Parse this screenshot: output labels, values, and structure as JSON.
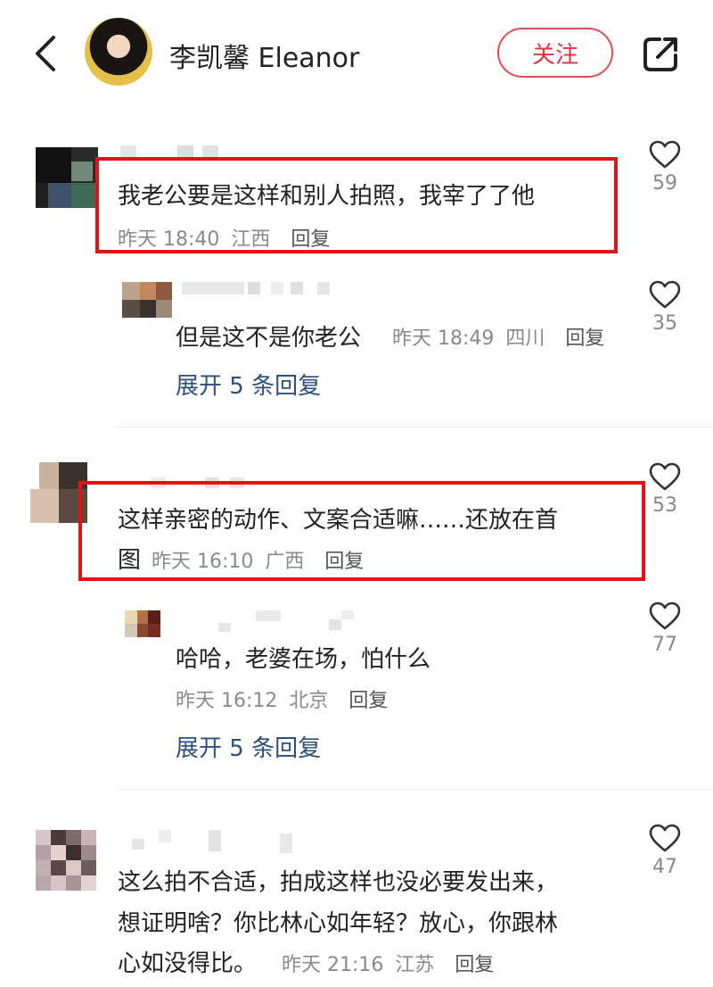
{
  "header": {
    "author_name": "李凯馨 Eleanor",
    "follow_label": "关注"
  },
  "comments": [
    {
      "text": "我老公要是这样和别人拍照，我宰了了他",
      "time": "昨天 18:40",
      "location": "江西",
      "reply_label": "回复",
      "likes": "59",
      "sub": {
        "text": "但是这不是你老公",
        "time": "昨天 18:49",
        "location": "四川",
        "reply_label": "回复",
        "likes": "35",
        "expand_label": "展开 5 条回复"
      }
    },
    {
      "text_line1": "这样亲密的动作、文案合适嘛……还放在首",
      "text_line2": "图",
      "time": "昨天 16:10",
      "location": "广西",
      "reply_label": "回复",
      "likes": "53",
      "sub": {
        "text": "哈哈，老婆在场，怕什么",
        "time": "昨天 16:12",
        "location": "北京",
        "reply_label": "回复",
        "likes": "77",
        "expand_label": "展开 5 条回复"
      }
    },
    {
      "text_line1": "这么拍不合适，拍成这样也没必要发出来，",
      "text_line2": "想证明啥？你比林心如年轻？放心，你跟林",
      "text_line3": "心如没得比。",
      "time": "昨天 21:16",
      "location": "江苏",
      "reply_label": "回复",
      "likes": "47"
    }
  ],
  "icons": {
    "back": "chevron-left-icon",
    "share": "share-icon",
    "like": "heart-outline-icon"
  },
  "colors": {
    "accent_red": "#e5333f",
    "highlight_box": "#e01414",
    "link_blue": "#2e4f7c",
    "meta_gray": "#8a8a8a"
  }
}
